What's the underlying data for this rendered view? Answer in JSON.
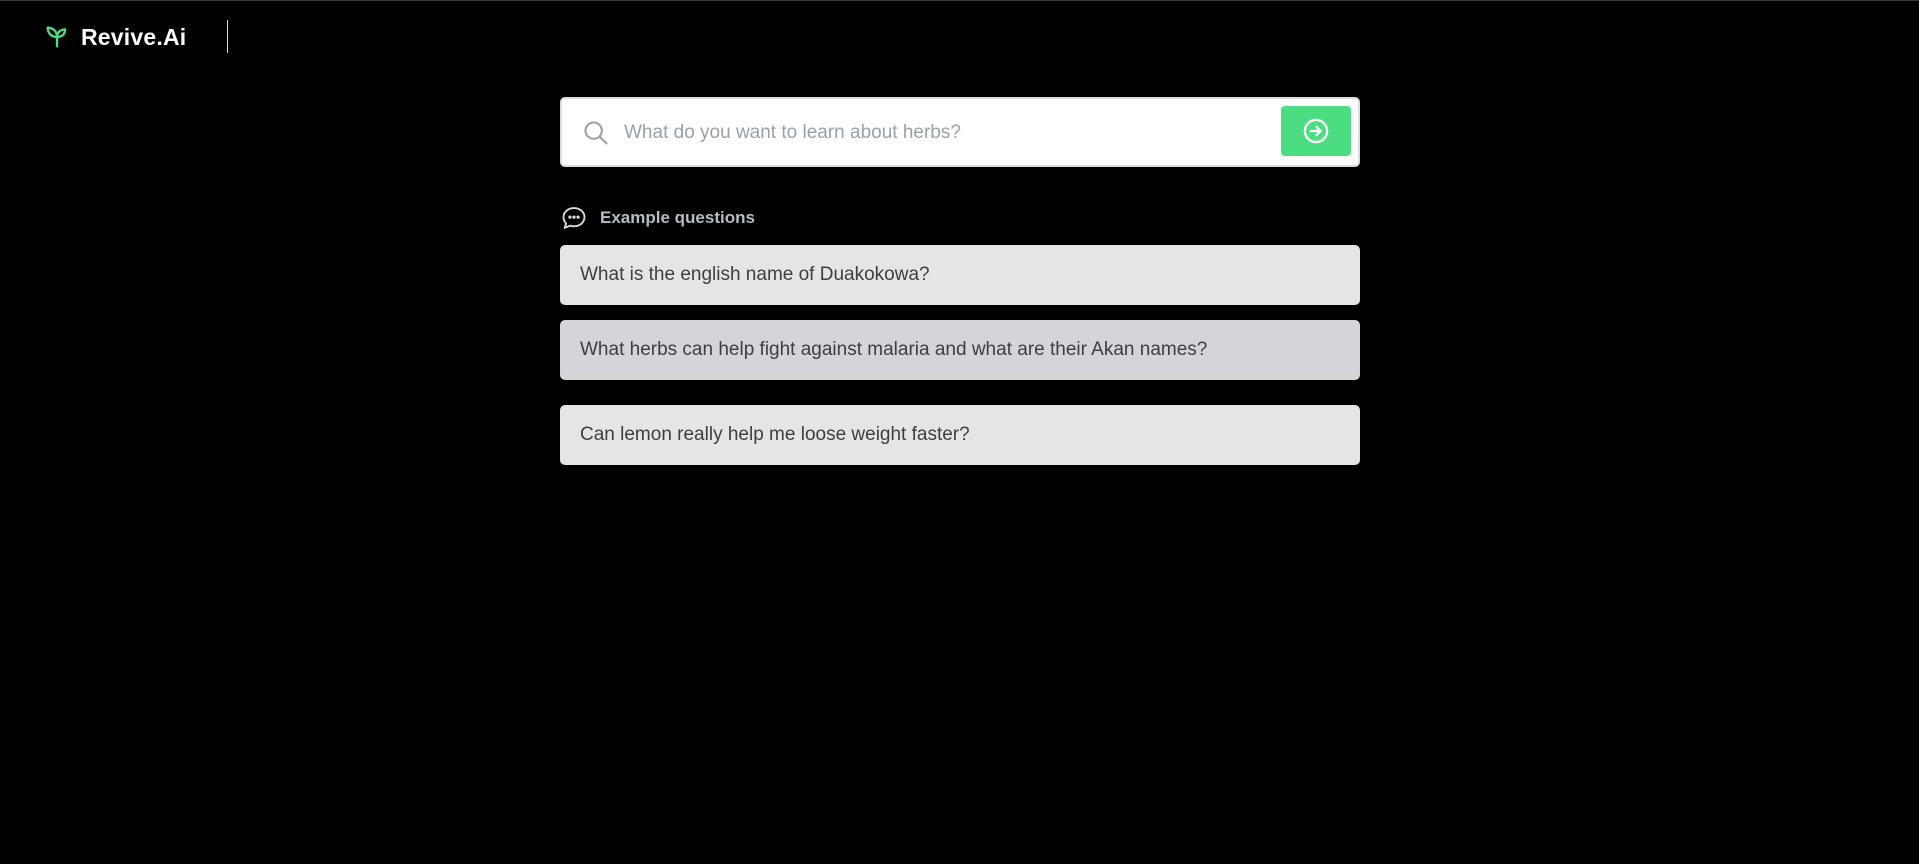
{
  "header": {
    "brand_name": "Revive.Ai",
    "brand_icon": "sprout-icon",
    "brand_color": "#4ade80"
  },
  "search": {
    "placeholder": "What do you want to learn about herbs?",
    "value": "",
    "submit_icon": "arrow-right-circle-icon",
    "submit_color": "#4ade80"
  },
  "examples": {
    "title": "Example questions",
    "icon": "chat-bubble-icon",
    "questions": [
      "What is the english name of Duakokowa?",
      "What herbs can help fight against malaria and what are their Akan names?",
      "Can lemon really help me loose weight faster?"
    ]
  }
}
